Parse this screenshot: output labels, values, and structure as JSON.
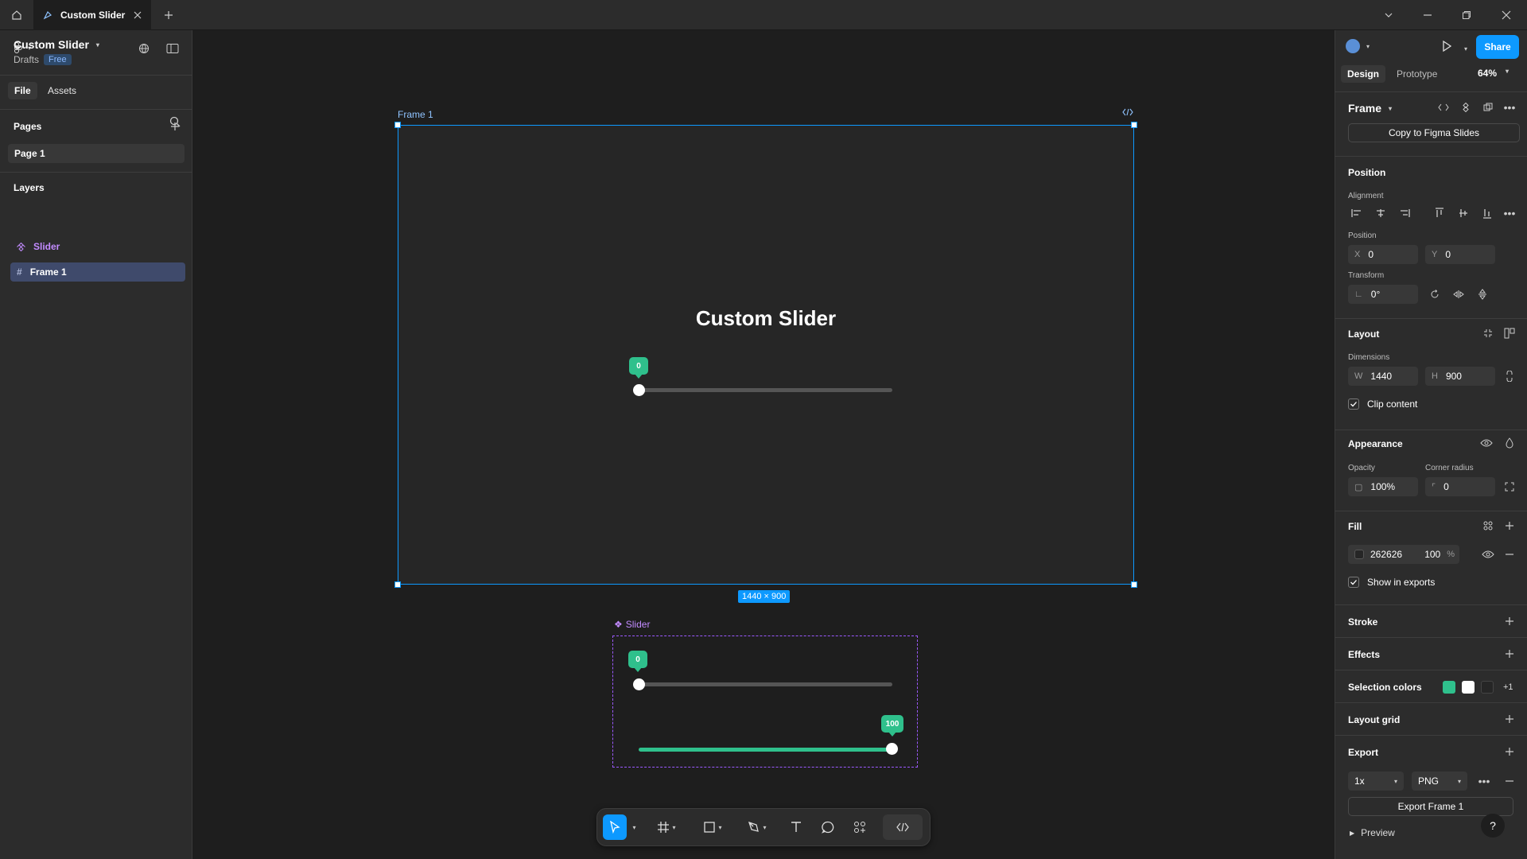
{
  "tabbar": {
    "tab_title": "Custom Slider"
  },
  "left": {
    "project_title": "Custom Slider",
    "drafts": "Drafts",
    "plan_badge": "Free",
    "tabs": [
      "File",
      "Assets"
    ],
    "pages_heading": "Pages",
    "pages": [
      "Page 1"
    ],
    "layers_heading": "Layers",
    "layers": [
      {
        "name": "Slider",
        "kind": "component"
      },
      {
        "name": "Frame 1",
        "kind": "frame",
        "selected": true
      }
    ]
  },
  "canvas": {
    "frame_label": "Frame 1",
    "frame_title": "Custom Slider",
    "frame_slider": {
      "value": "0"
    },
    "dimensions_badge": "1440 × 900",
    "component_label": "Slider",
    "component_variants": [
      {
        "value": "0",
        "fraction": 0.0
      },
      {
        "value": "100",
        "fraction": 1.0
      }
    ]
  },
  "right": {
    "share_label": "Share",
    "tabs": [
      "Design",
      "Prototype"
    ],
    "zoom": "64%",
    "selection_type": "Frame",
    "copy_button": "Copy to Figma Slides",
    "position_heading": "Position",
    "alignment_label": "Alignment",
    "position_label": "Position",
    "x_prefix": "X",
    "x_value": "0",
    "y_prefix": "Y",
    "y_value": "0",
    "transform_label": "Transform",
    "rotation_value": "0°",
    "layout_heading": "Layout",
    "dimensions_label": "Dimensions",
    "w_prefix": "W",
    "w_value": "1440",
    "h_prefix": "H",
    "h_value": "900",
    "clip_content": "Clip content",
    "appearance_heading": "Appearance",
    "opacity_label": "Opacity",
    "opacity_value": "100%",
    "corner_radius_label": "Corner radius",
    "corner_radius_value": "0",
    "fill_heading": "Fill",
    "fill_hex": "262626",
    "fill_opacity": "100",
    "fill_pct": "%",
    "show_in_exports": "Show in exports",
    "stroke_heading": "Stroke",
    "effects_heading": "Effects",
    "selection_colors_heading": "Selection colors",
    "selection_colors": [
      "#2fc08c",
      "#ffffff",
      "#262626"
    ],
    "selection_colors_more": "+1",
    "layout_grid_heading": "Layout grid",
    "export_heading": "Export",
    "export_scale": "1x",
    "export_format": "PNG",
    "export_button": "Export Frame 1",
    "preview_label": "Preview",
    "help": "?"
  },
  "colors": {
    "accent": "#0d99ff",
    "slider_fill": "#2fc08c",
    "component": "#c28bff"
  }
}
